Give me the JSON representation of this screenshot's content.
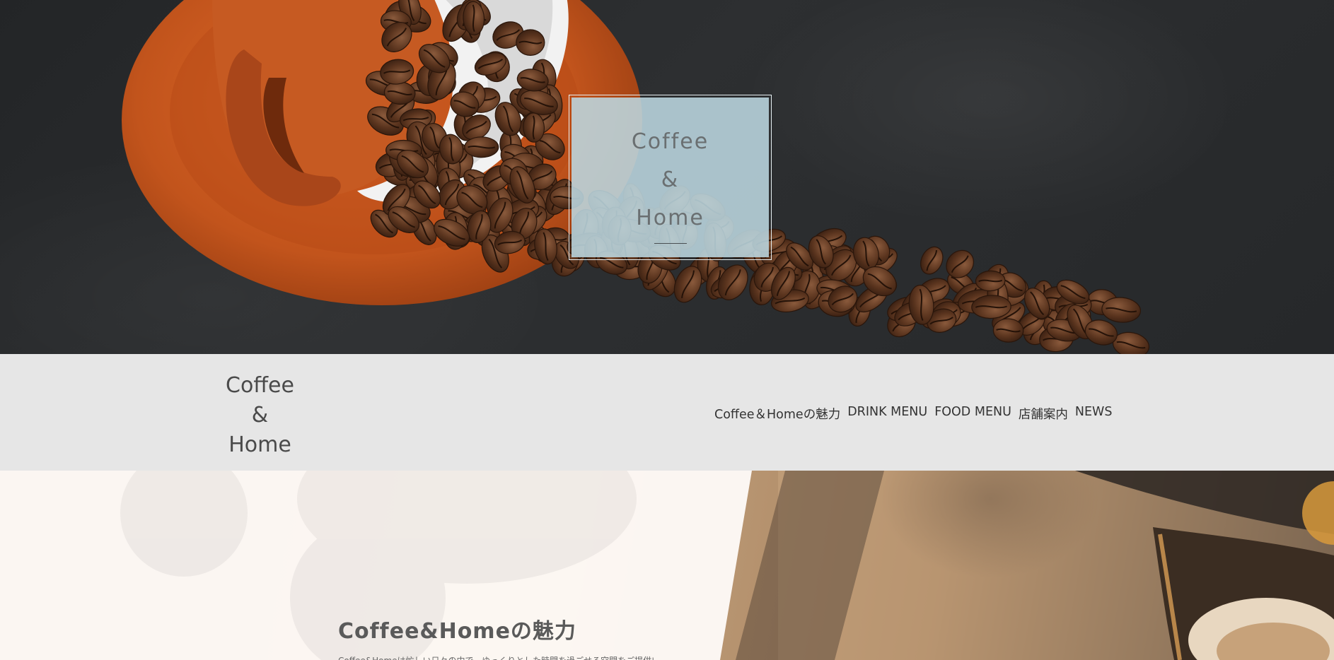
{
  "hero": {
    "title_lines": [
      "Coffee",
      "&",
      "Home"
    ],
    "background_color": "#26282a",
    "cup_color": "#c2541c",
    "box_color": "#bcd7e0"
  },
  "navbar": {
    "logo_lines": [
      "Coffee",
      "&",
      "Home"
    ],
    "links": [
      "Coffee＆Homeの魅力",
      "DRINK MENU",
      "FOOD MENU",
      "店舗案内",
      "NEWS"
    ],
    "background_color": "#e6e6e6"
  },
  "feature": {
    "title": "Coffee&Homeの魅力",
    "body": "Coffee&Homeは忙しい日々の中で、ゆっくりとした時間を過ごせる空間をご提供いたします。"
  }
}
